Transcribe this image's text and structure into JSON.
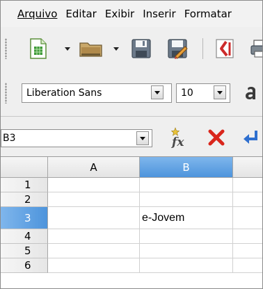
{
  "menubar": {
    "items": [
      {
        "label": "Arquivo"
      },
      {
        "label": "Editar"
      },
      {
        "label": "Exibir"
      },
      {
        "label": "Inserir"
      },
      {
        "label": "Formatar"
      }
    ]
  },
  "toolbar": {
    "icons": [
      "new-spreadsheet-icon",
      "open-folder-icon",
      "save-icon",
      "edit-file-icon",
      "export-pdf-icon",
      "print-icon"
    ]
  },
  "format_toolbar": {
    "font_name": "Liberation Sans",
    "font_size": "10",
    "icons": [
      "font-color-icon"
    ]
  },
  "formula_bar": {
    "name_box": "B3",
    "icons": [
      "function-wizard-icon",
      "cancel-icon",
      "accept-icon"
    ]
  },
  "grid": {
    "columns": [
      "A",
      "B"
    ],
    "selected_column": "B",
    "rows": [
      "1",
      "2",
      "3",
      "4",
      "5",
      "6"
    ],
    "selected_row": "3",
    "cells": {
      "B3": "e-Jovem"
    }
  },
  "colors": {
    "selection_header": "#5b9fe3",
    "toolbar_bg": "#efefef",
    "cancel_red": "#d9261c",
    "accept_blue": "#2e6fcf"
  }
}
